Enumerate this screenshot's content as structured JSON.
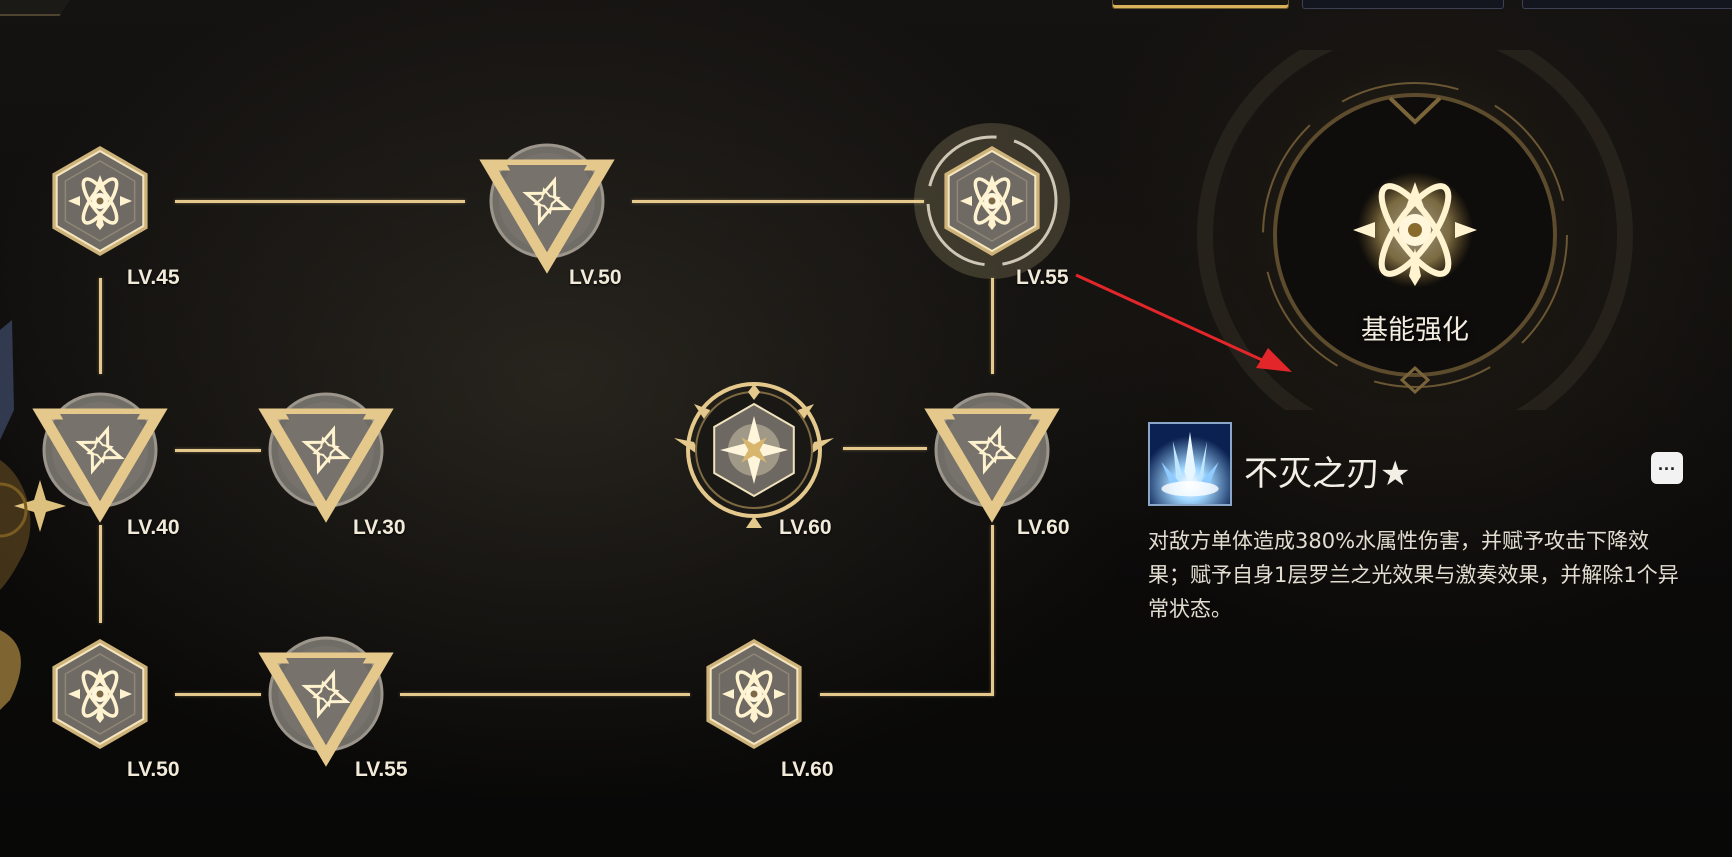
{
  "colors": {
    "gold": "#e5c98c",
    "node_fill": "#77736c",
    "node_fill_dark": "#5d5a54",
    "background": "#0b0a09"
  },
  "tree": {
    "nodes": [
      {
        "id": "n45",
        "level_label": "LV.45",
        "shape": "hexagon",
        "icon": "atom-icon"
      },
      {
        "id": "n50a",
        "level_label": "LV.50",
        "shape": "triangle-ring",
        "icon": "compass-star-icon"
      },
      {
        "id": "n55a",
        "level_label": "LV.55",
        "shape": "hexagon",
        "icon": "atom-icon",
        "selected": true
      },
      {
        "id": "n40",
        "level_label": "LV.40",
        "shape": "triangle-ring",
        "icon": "compass-star-icon"
      },
      {
        "id": "n30",
        "level_label": "LV.30",
        "shape": "triangle-ring",
        "icon": "compass-star-icon"
      },
      {
        "id": "n60core",
        "level_label": "LV.60",
        "shape": "core-hexagon",
        "icon": "four-point-star-icon"
      },
      {
        "id": "n60b",
        "level_label": "LV.60",
        "shape": "triangle-ring",
        "icon": "compass-star-icon"
      },
      {
        "id": "n50b",
        "level_label": "LV.50",
        "shape": "hexagon",
        "icon": "atom-icon"
      },
      {
        "id": "n55b",
        "level_label": "LV.55",
        "shape": "triangle-ring",
        "icon": "compass-star-icon"
      },
      {
        "id": "n60c",
        "level_label": "LV.60",
        "shape": "hexagon",
        "icon": "atom-icon"
      }
    ]
  },
  "detail": {
    "emblem_title": "基能强化",
    "emblem_icon": "atom-icon",
    "skill_icon": "blade-burst-icon",
    "skill_name": "不灭之刃★",
    "more_label": "...",
    "description": "对敌方单体造成380%水属性伤害，并赋予攻击下降效果；赋予自身1层罗兰之光效果与激奏效果，并解除1个异常状态。"
  }
}
